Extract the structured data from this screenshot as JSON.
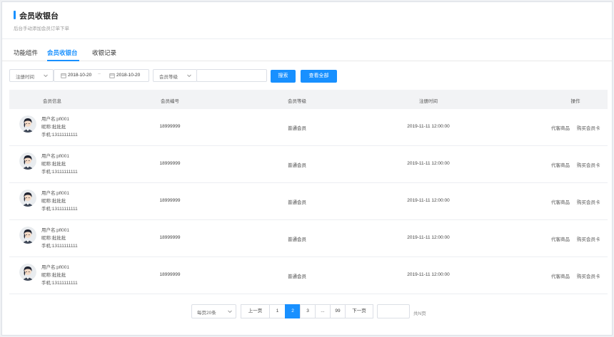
{
  "header": {
    "title": "会员收银台",
    "subtitle": "后台手动添加会员订单下单"
  },
  "tabs": [
    {
      "label": "功能组件"
    },
    {
      "label": "会员收银台",
      "active": true
    },
    {
      "label": "收银记录"
    }
  ],
  "filters": {
    "date_type": "注册时间",
    "date_start": "2018-10-20",
    "date_sep": "~",
    "date_end": "2018-10-20",
    "level_select": "会员等级",
    "keyword_value": "",
    "search_label": "搜索",
    "view_all_label": "查看全部"
  },
  "table": {
    "columns": [
      "会员信息",
      "会员编号",
      "会员等级",
      "注册时间",
      "操作"
    ],
    "rows": [
      {
        "username": "用户名:pfl001",
        "nickname": "昵称:批批批",
        "phone": "手机:13111111111",
        "member_no": "18999999",
        "level": "普通会员",
        "registered": "2019-11-11  12:00:00",
        "op1": "代客商品",
        "op2": "购买会员卡"
      },
      {
        "username": "用户名:pfl001",
        "nickname": "昵称:批批批",
        "phone": "手机:13111111111",
        "member_no": "18999999",
        "level": "普通会员",
        "registered": "2019-11-11  12:00:00",
        "op1": "代客商品",
        "op2": "购买会员卡"
      },
      {
        "username": "用户名:pfl001",
        "nickname": "昵称:批批批",
        "phone": "手机:13111111111",
        "member_no": "18999999",
        "level": "普通会员",
        "registered": "2019-11-11  12:00:00",
        "op1": "代客商品",
        "op2": "购买会员卡"
      },
      {
        "username": "用户名:pfl001",
        "nickname": "昵称:批批批",
        "phone": "手机:13111111111",
        "member_no": "18999999",
        "level": "普通会员",
        "registered": "2019-11-11  12:00:00",
        "op1": "代客商品",
        "op2": "购买会员卡"
      },
      {
        "username": "用户名:pfl001",
        "nickname": "昵称:批批批",
        "phone": "手机:13111111111",
        "member_no": "18999999",
        "level": "普通会员",
        "registered": "2019-11-11  12:00:00",
        "op1": "代客商品",
        "op2": "购买会员卡"
      }
    ]
  },
  "pagination": {
    "page_size": "每页20条",
    "prev": "上一页",
    "pages": [
      "1",
      "2",
      "3",
      "...",
      "99"
    ],
    "current": "2",
    "next": "下一页",
    "jump_value": "",
    "total": "共N页"
  },
  "colors": {
    "accent": "#1890ff",
    "header_bg": "#f2f3f5"
  }
}
